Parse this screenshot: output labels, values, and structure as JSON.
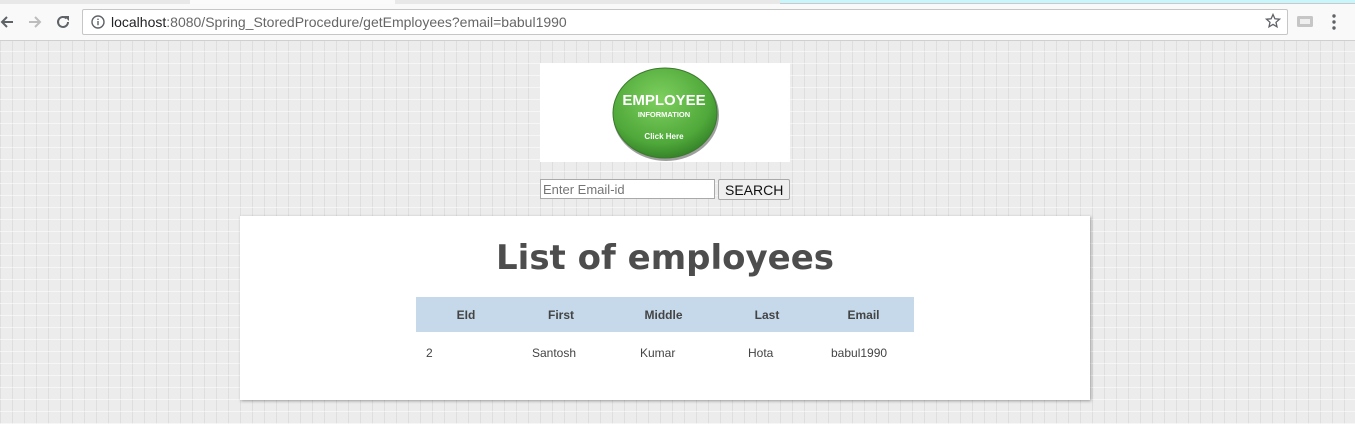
{
  "browser": {
    "url_host": "localhost",
    "url_rest": ":8080/Spring_StoredProcedure/getEmployees?email=babul1990"
  },
  "logo": {
    "line1": "EMPLOYEE",
    "line2": "INFORMATION",
    "line3": "Click Here",
    "color": "#5cb044"
  },
  "search": {
    "placeholder": "Enter Email-id",
    "value": "",
    "button_label": "SEARCH"
  },
  "panel": {
    "title": "List of employees"
  },
  "table": {
    "headers": [
      "EId",
      "First",
      "Middle",
      "Last",
      "Email"
    ],
    "rows": [
      [
        "2",
        "Santosh",
        "Kumar",
        "Hota",
        "babul1990"
      ]
    ],
    "header_bg": "#c5d9ea"
  }
}
